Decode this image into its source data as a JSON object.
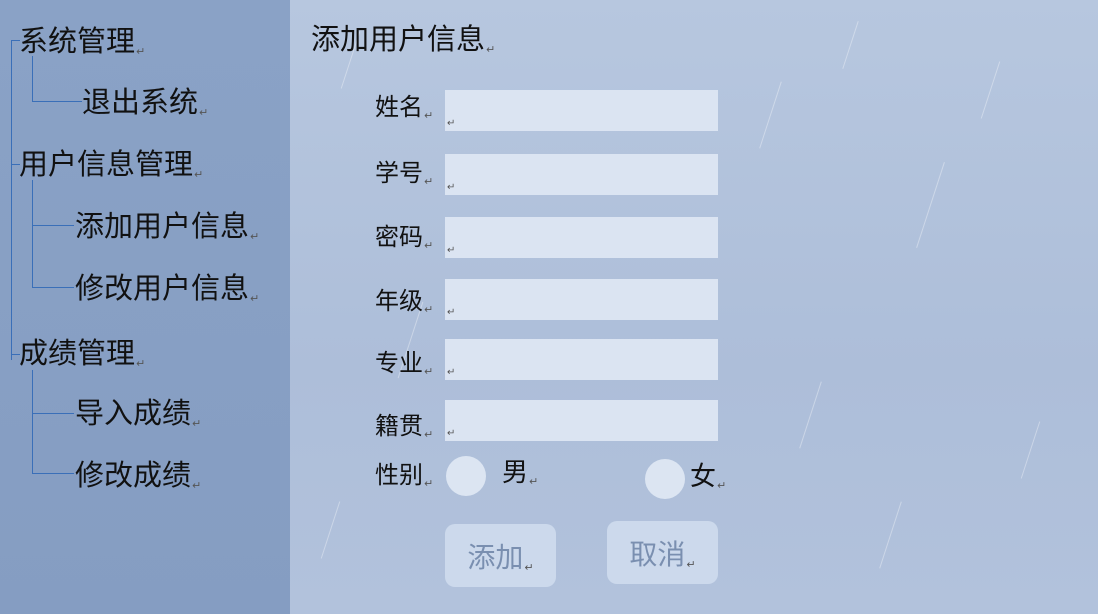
{
  "sidebar": {
    "groups": [
      {
        "label": "系统管理",
        "items": [
          {
            "label": "退出系统"
          }
        ]
      },
      {
        "label": "用户信息管理",
        "items": [
          {
            "label": "添加用户信息"
          },
          {
            "label": "修改用户信息"
          }
        ]
      },
      {
        "label": "成绩管理",
        "items": [
          {
            "label": "导入成绩"
          },
          {
            "label": "修改成绩"
          }
        ]
      }
    ]
  },
  "form": {
    "title": "添加用户信息",
    "fields": [
      {
        "label": "姓名",
        "value": ""
      },
      {
        "label": "学号",
        "value": ""
      },
      {
        "label": "密码",
        "value": ""
      },
      {
        "label": "年级",
        "value": ""
      },
      {
        "label": "专业",
        "value": ""
      },
      {
        "label": "籍贯",
        "value": ""
      }
    ],
    "gender": {
      "label": "性别",
      "options": [
        "男",
        "女"
      ]
    },
    "buttons": {
      "add": "添加",
      "cancel": "取消"
    }
  },
  "paragraph_mark": "↵",
  "colors": {
    "sidebar": "#8aa2c6",
    "main": "#aebfda",
    "tree_line": "#3a6fb8",
    "input": "#dbe4f2",
    "button_text": "#7a8fb0"
  }
}
